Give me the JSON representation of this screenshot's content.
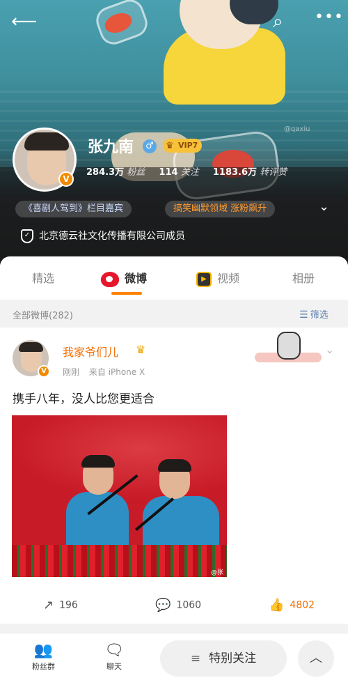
{
  "header": {
    "back_icon": "back-arrow-icon",
    "search_icon": "search-icon",
    "more_icon": "more-icon",
    "cover_watermark": "@qaxiu"
  },
  "profile": {
    "name": "张九南",
    "vip_label": "VIP7",
    "stats": {
      "followers_value": "284.3万",
      "followers_label": "粉丝",
      "following_value": "114",
      "following_label": "关注",
      "reposts_value": "1183.6万",
      "reposts_label": "转评赞"
    },
    "tags": [
      "《喜剧人驾到》栏目嘉宾",
      "搞笑幽默领域 涨粉飙升"
    ],
    "organization": "北京德云社文化传播有限公司成员"
  },
  "tabs": [
    "精选",
    "微博",
    "视频",
    "相册"
  ],
  "filter": {
    "count_label": "全部微博(282)",
    "filter_label": "筛选"
  },
  "post": {
    "author": "我家爷们儿",
    "time": "刚刚",
    "source": "来自 iPhone X",
    "text": "携手八年，没人比您更适合",
    "image_watermark": "@张",
    "reposts": "196",
    "comments": "1060",
    "likes": "4802"
  },
  "bottom_bar": {
    "fans_group_label": "粉丝群",
    "chat_label": "聊天",
    "special_follow_label": "特别关注"
  },
  "colors": {
    "accent": "#ff8200",
    "weibo_red": "#e6162d",
    "name_orange": "#f26d00",
    "link_blue": "#5a7fb0"
  }
}
